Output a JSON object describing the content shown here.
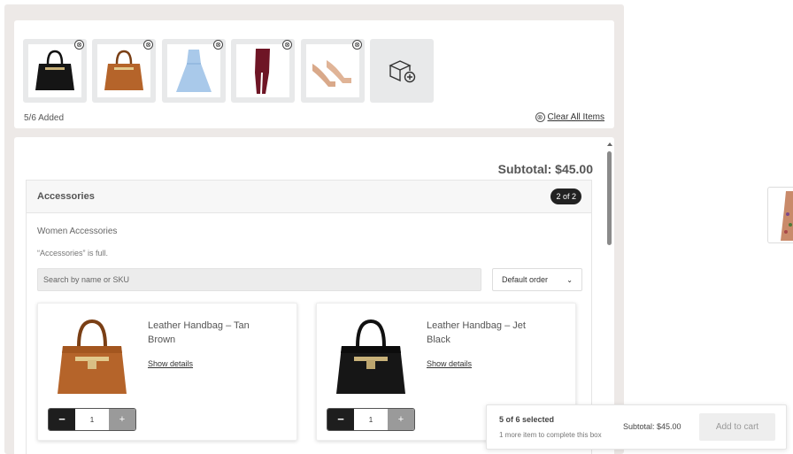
{
  "added": {
    "items": [
      {
        "name": "Leather Handbag – Jet Black",
        "icon": "black-handbag-image"
      },
      {
        "name": "Leather Handbag – Tan Brown",
        "icon": "tan-handbag-image"
      },
      {
        "name": "Blue Dress",
        "icon": "blue-dress-image"
      },
      {
        "name": "Leggings",
        "icon": "maroon-leggings-image"
      },
      {
        "name": "Heels",
        "icon": "nude-heels-image"
      }
    ],
    "remove_glyph": "⊗",
    "count_label": "5/6 Added",
    "clear_label": "Clear All Items",
    "clear_glyph": "⊗"
  },
  "main": {
    "subtotal_label": "Subtotal: $45.00"
  },
  "section": {
    "title": "Accessories",
    "badge": "2 of 2",
    "subtitle": "Women Accessories",
    "note": "“Accessories” is full.",
    "search_placeholder": "Search by name or SKU",
    "order_label": "Default order",
    "order_chevron": "⌄"
  },
  "products": [
    {
      "name": "Leather Handbag – Tan Brown",
      "details": "Show details",
      "qty": "1",
      "minus": "−",
      "plus": "+",
      "color": "#b5642a"
    },
    {
      "name": "Leather Handbag – Jet Black",
      "details": "Show details",
      "qty": "1",
      "minus": "−",
      "plus": "+",
      "color": "#1a1a1a"
    }
  ],
  "floatbar": {
    "count": "5 of 6 selected",
    "note": "1 more item to complete this box",
    "subtotal": "Subtotal: $45.00",
    "cart_label": "Add to cart"
  },
  "colors": {
    "accent_dark": "#222222",
    "panel_bg": "#ede9e7"
  }
}
